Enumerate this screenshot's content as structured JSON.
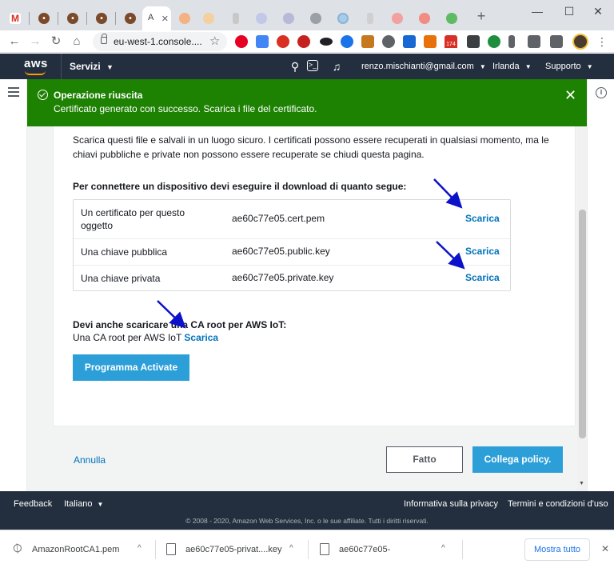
{
  "browser": {
    "url": "eu-west-1.console....",
    "tab_active_letter": "A",
    "show_all_label": "Mostra tutto",
    "downloads": [
      {
        "name": "AmazonRootCA1.pem"
      },
      {
        "name": "ae60c77e05-privat....key"
      },
      {
        "name": "ae60c77e05-"
      }
    ],
    "extension_badge": "174"
  },
  "aws_header": {
    "logo": "aws",
    "services_label": "Servizi",
    "account": "renzo.mischianti@gmail.com",
    "region": "Irlanda",
    "support": "Supporto"
  },
  "flash": {
    "title": "Operazione riuscita",
    "message": "Certificato generato con successo. Scarica i file del certificato."
  },
  "main": {
    "intro": "Scarica questi file e salvali in un luogo sicuro. I certificati possono essere recuperati in qualsiasi momento, ma le chiavi pubbliche e private non possono essere recuperate se chiudi questa pagina.",
    "downloads_heading": "Per connettere un dispositivo devi eseguire il download di quanto segue:",
    "files": [
      {
        "description": "Un certificato per questo oggetto",
        "filename": "ae60c77e05.cert.pem",
        "action": "Scarica"
      },
      {
        "description": "Una chiave pubblica",
        "filename": "ae60c77e05.public.key",
        "action": "Scarica"
      },
      {
        "description": "Una chiave privata",
        "filename": "ae60c77e05.private.key",
        "action": "Scarica"
      }
    ],
    "ca_heading": "Devi anche scaricare una CA root per AWS IoT:",
    "ca_text": "Una CA root per AWS IoT",
    "ca_action": "Scarica",
    "activate_button": "Programma Activate",
    "cancel_link": "Annulla",
    "done_button": "Fatto",
    "attach_policy_button": "Collega policy."
  },
  "footer": {
    "feedback": "Feedback",
    "language": "Italiano",
    "privacy": "Informativa sulla privacy",
    "terms": "Termini e condizioni d'uso",
    "copyright": "© 2008 - 2020, Amazon Web Services, Inc. o le sue affiliate. Tutti i diritti riservati."
  },
  "colors": {
    "aws_navy": "#232f3e",
    "aws_orange": "#ff9900",
    "success_green": "#1d8102",
    "link_blue": "#0073bb",
    "primary_button": "#2d9fd8",
    "annotation_arrow": "#0b12c9"
  }
}
